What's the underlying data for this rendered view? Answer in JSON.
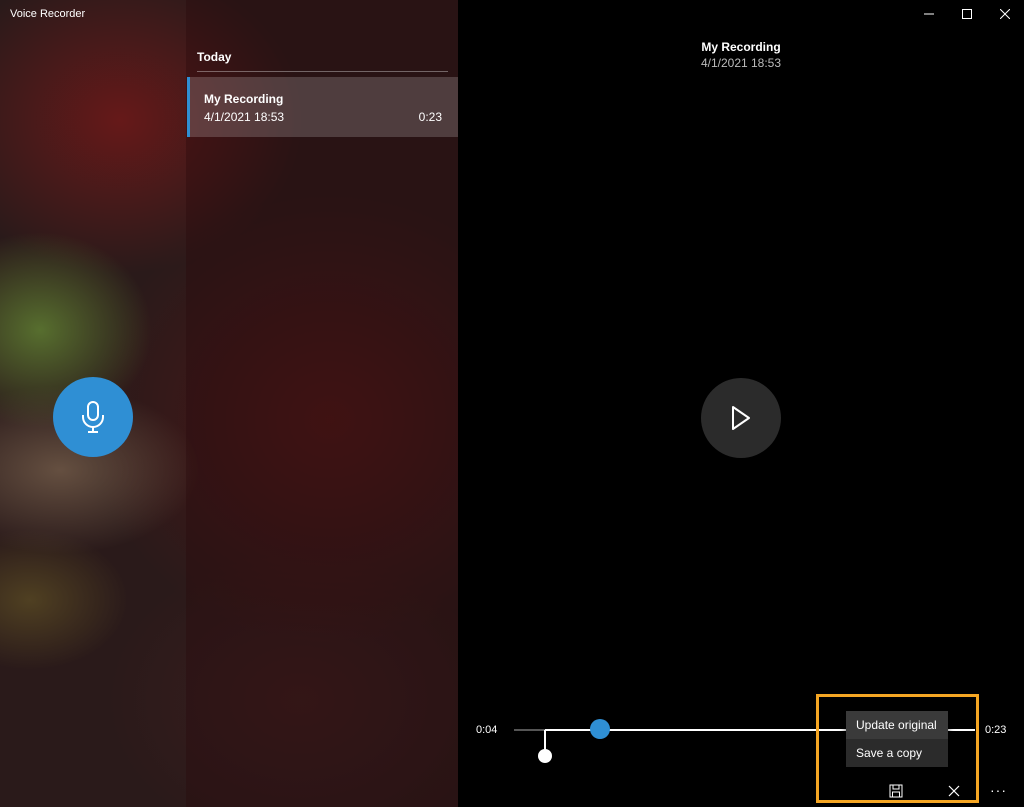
{
  "app": {
    "title": "Voice Recorder"
  },
  "list": {
    "group_header": "Today",
    "items": [
      {
        "title": "My Recording",
        "date": "4/1/2021 18:53",
        "duration": "0:23"
      }
    ]
  },
  "detail": {
    "title": "My Recording",
    "date": "4/1/2021 18:53"
  },
  "playback": {
    "start_time": "0:04",
    "end_time": "0:23"
  },
  "save_menu": {
    "items": [
      "Update original",
      "Save a copy"
    ]
  },
  "icons": {
    "record": "microphone-icon",
    "play": "play-icon",
    "save": "save-icon",
    "cancel": "close-icon",
    "more": "more-icon",
    "minimize": "minimize-icon",
    "maximize": "maximize-icon",
    "close": "window-close-icon"
  },
  "colors": {
    "accent": "#2f8fd4",
    "highlight": "#f5a623"
  }
}
